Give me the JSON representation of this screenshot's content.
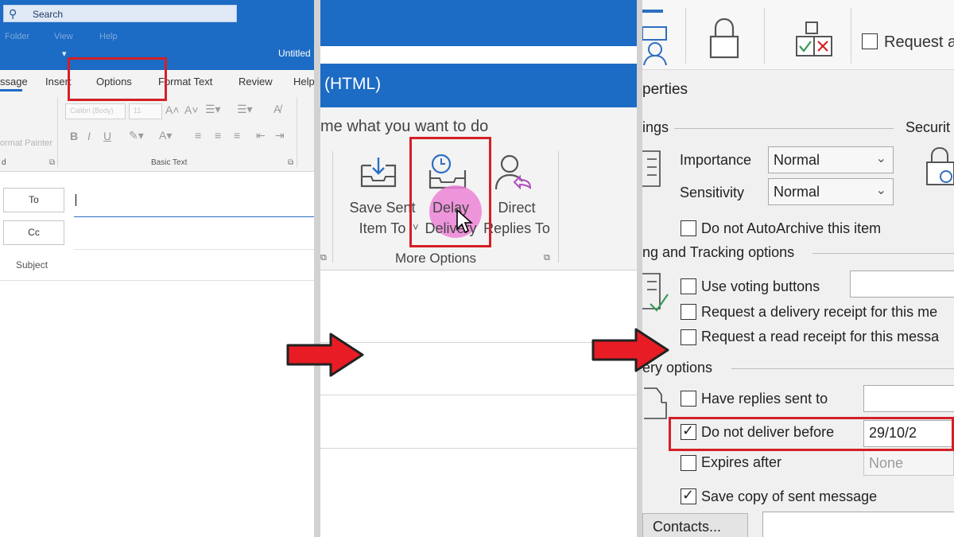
{
  "panel1": {
    "search_placeholder": "Search",
    "menu_items": [
      "Folder",
      "View",
      "Help"
    ],
    "window_title": "Untitled",
    "tabs": [
      "ssage",
      "Insert",
      "Options",
      "Format Text",
      "Review",
      "Help"
    ],
    "font_name": "Calibri (Body)",
    "font_size": "11",
    "format_painter": "ormat Painter",
    "group_left": "d",
    "group_basic_text": "Basic Text",
    "to_label": "To",
    "cc_label": "Cc",
    "subject_label": "Subject"
  },
  "panel2": {
    "title": "(HTML)",
    "tellme": "me what you want to do",
    "save_sent": [
      "Save Sent",
      "Item To"
    ],
    "delay_delivery": [
      "Delay",
      "Delivery"
    ],
    "direct_replies": [
      "Direct",
      "Replies To"
    ],
    "group_more_options": "More Options"
  },
  "panel3": {
    "request_a": "Request a",
    "properties_title": "perties",
    "settings_header": "ings",
    "security_header": "Securit",
    "importance_label": "Importance",
    "importance_value": "Normal",
    "sensitivity_label": "Sensitivity",
    "sensitivity_value": "Normal",
    "no_autoarchive": "Do not AutoArchive this item",
    "voting_tracking_header": "ng and Tracking options",
    "use_voting_buttons": "Use voting buttons",
    "request_delivery_receipt": "Request a delivery receipt for this me",
    "request_read_receipt": "Request a read receipt for this messa",
    "delivery_options_header": "ery options",
    "have_replies_sent_to": "Have replies sent to",
    "do_not_deliver_before": "Do not deliver before",
    "deliver_date": "29/10/2",
    "expires_after": "Expires after",
    "expires_value": "None",
    "save_copy": "Save copy of sent message",
    "contacts_button": "Contacts...",
    "checkbox_states": {
      "no_autoarchive": false,
      "use_voting_buttons": false,
      "request_delivery_receipt": false,
      "request_read_receipt": false,
      "have_replies_sent_to": false,
      "do_not_deliver_before": true,
      "expires_after": false,
      "save_copy": true
    }
  },
  "colors": {
    "outlook_blue": "#1c6bc4",
    "highlight_red": "#d41f26",
    "arrow_red": "#e81c24",
    "cursor_pink": "#ec82d6"
  }
}
